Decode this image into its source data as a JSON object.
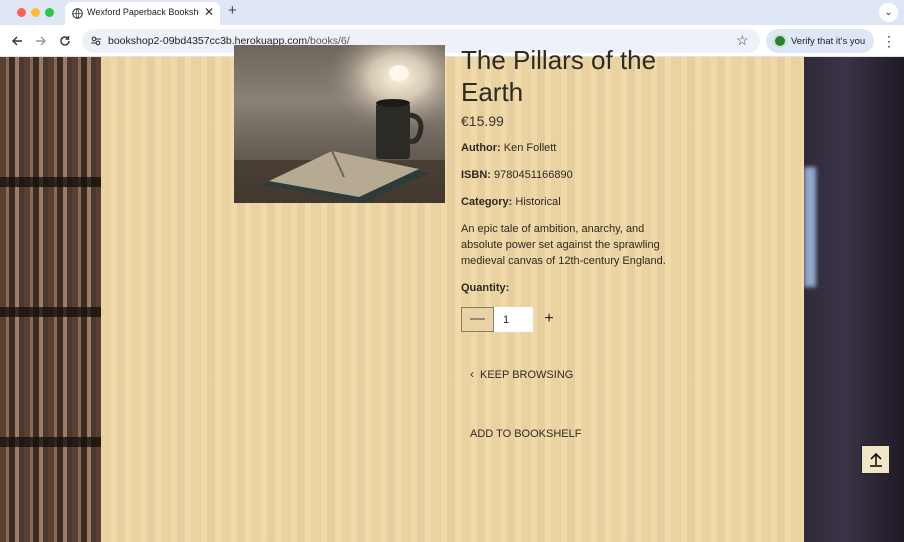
{
  "browser": {
    "tab_title": "Wexford Paperback Bookshop",
    "tab_close": "✕",
    "new_tab": "+",
    "tab_menu": "⌄",
    "url_host": "bookshop2-09bd4357cc3b.herokuapp.com",
    "url_path": "/books/6/",
    "verify_label": "Verify that it's you",
    "traffic_lights": [
      "#fe5f57",
      "#febc2e",
      "#28c840"
    ]
  },
  "book": {
    "title": "The Pillars of the Earth",
    "price": "€15.99",
    "author_label": "Author:",
    "author": "Ken Follett",
    "isbn_label": "ISBN:",
    "isbn": "9780451166890",
    "category_label": "Category:",
    "category": "Historical",
    "description": "An epic tale of ambition, anarchy, and absolute power set against the sprawling medieval canvas of 12th-century England."
  },
  "quantity": {
    "label": "Quantity:",
    "value": "1",
    "minus": "—",
    "plus": "+"
  },
  "actions": {
    "keep_browsing": "KEEP BROWSING",
    "add_to_bookshelf": "ADD TO BOOKSHELF"
  }
}
